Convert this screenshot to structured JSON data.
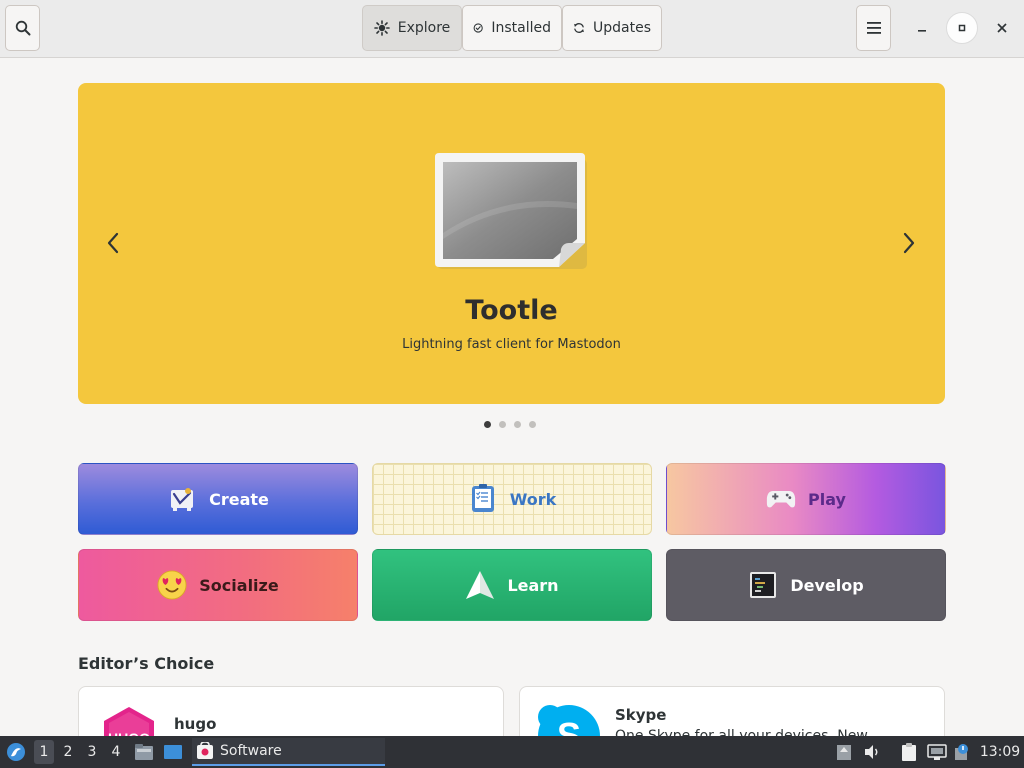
{
  "header": {
    "search_icon": "search-icon",
    "tabs": [
      {
        "label": "Explore",
        "icon": "explore-icon",
        "active": true
      },
      {
        "label": "Installed",
        "icon": "check-icon",
        "active": false
      },
      {
        "label": "Updates",
        "icon": "refresh-icon",
        "active": false
      }
    ],
    "menu_icon": "hamburger-menu-icon",
    "window_controls": [
      "minimize-icon",
      "maximize-icon",
      "close-icon"
    ]
  },
  "featured": {
    "app_name": "Tootle",
    "summary": "Lightning fast client for Mastodon",
    "background": "#f4c73d",
    "pages": 4,
    "current_page": 1
  },
  "categories": [
    {
      "label": "Create",
      "icon": "create-icon"
    },
    {
      "label": "Work",
      "icon": "work-icon"
    },
    {
      "label": "Play",
      "icon": "gamepad-icon"
    },
    {
      "label": "Socialize",
      "icon": "heart-eyes-emoji-icon"
    },
    {
      "label": "Learn",
      "icon": "paper-plane-icon"
    },
    {
      "label": "Develop",
      "icon": "terminal-icon"
    }
  ],
  "editors_choice": {
    "title": "Editor’s Choice",
    "apps": [
      {
        "name": "hugo",
        "icon": "hugo-icon"
      },
      {
        "name": "Skype",
        "icon": "skype-icon",
        "description": "One Skype for all your devices. New"
      }
    ]
  },
  "taskbar": {
    "workspaces": [
      "1",
      "2",
      "3",
      "4"
    ],
    "active_workspace": "1",
    "task_label": "Software",
    "clock": "13:09"
  },
  "colors": {
    "accent": "#3584e4",
    "featured_bg": "#f4c73d",
    "taskbar_bg": "#2f3136"
  }
}
